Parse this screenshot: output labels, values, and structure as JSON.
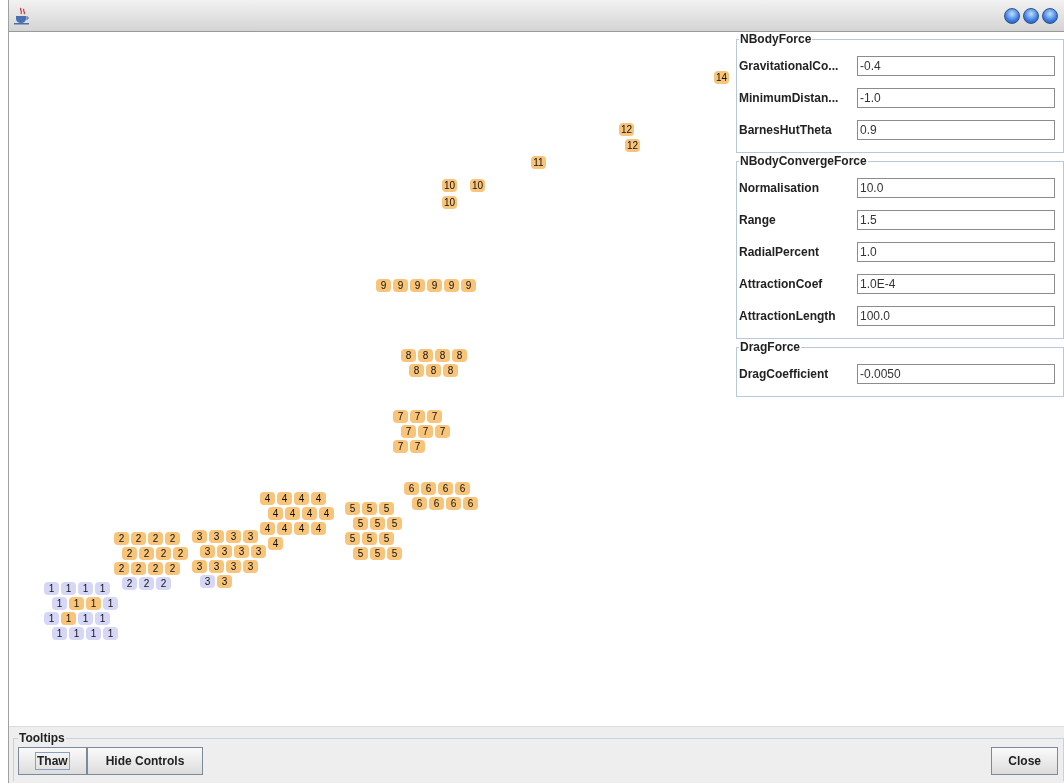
{
  "graph": {
    "clusters": [
      {
        "nodes": [
          {
            "label": "14",
            "color": "#f7c47a"
          }
        ]
      },
      {
        "nodes": [
          {
            "label": "12",
            "color": "#f7c47a"
          },
          {
            "label": "12",
            "color": "#f7c47a"
          }
        ]
      },
      {
        "nodes": [
          {
            "label": "11",
            "color": "#f7c47a"
          }
        ]
      },
      {
        "nodes": [
          {
            "label": "10",
            "color": "#f7c47a"
          },
          {
            "label": "10",
            "color": "#f7c47a"
          },
          {
            "label": "10",
            "color": "#f7c47a"
          }
        ]
      },
      {
        "nodes": [
          {
            "label": "9",
            "color": "#f7c47a"
          },
          {
            "label": "9",
            "color": "#f7c47a"
          },
          {
            "label": "9",
            "color": "#f7c47a"
          },
          {
            "label": "9",
            "color": "#f7c47a"
          },
          {
            "label": "9",
            "color": "#f7c47a"
          },
          {
            "label": "9",
            "color": "#f7c47a"
          }
        ]
      },
      {
        "nodes": [
          {
            "label": "8",
            "color": "#f7c47a"
          },
          {
            "label": "8",
            "color": "#f7c47a"
          },
          {
            "label": "8",
            "color": "#f7c47a"
          },
          {
            "label": "8",
            "color": "#f7c47a"
          },
          {
            "label": "8",
            "color": "#f7c47a"
          },
          {
            "label": "8",
            "color": "#f7c47a"
          },
          {
            "label": "8",
            "color": "#f7c47a"
          }
        ]
      },
      {
        "nodes": [
          {
            "label": "7",
            "color": "#f7c47a"
          },
          {
            "label": "7",
            "color": "#f7c47a"
          },
          {
            "label": "7",
            "color": "#f7c47a"
          },
          {
            "label": "7",
            "color": "#f7c47a"
          },
          {
            "label": "7",
            "color": "#f7c47a"
          },
          {
            "label": "7",
            "color": "#f7c47a"
          },
          {
            "label": "7",
            "color": "#f7c47a"
          },
          {
            "label": "7",
            "color": "#f7c47a"
          }
        ]
      },
      {
        "nodes": [
          {
            "label": "1",
            "color": "#d6d6f6"
          },
          {
            "label": "1",
            "color": "#d6d6f6"
          },
          {
            "label": "1",
            "color": "#d6d6f6"
          },
          {
            "label": "1",
            "color": "#d6d6f6"
          },
          {
            "label": "1",
            "color": "#d6d6f6"
          },
          {
            "label": "1",
            "color": "#f7c47a"
          },
          {
            "label": "1",
            "color": "#f7c47a"
          },
          {
            "label": "1",
            "color": "#d6d6f6"
          },
          {
            "label": "1",
            "color": "#d6d6f6"
          },
          {
            "label": "1",
            "color": "#f7c47a"
          },
          {
            "label": "1",
            "color": "#d6d6f6"
          },
          {
            "label": "1",
            "color": "#d6d6f6"
          },
          {
            "label": "1",
            "color": "#d6d6f6"
          },
          {
            "label": "1",
            "color": "#d6d6f6"
          },
          {
            "label": "1",
            "color": "#d6d6f6"
          },
          {
            "label": "1",
            "color": "#d6d6f6"
          }
        ]
      },
      {
        "nodes": [
          {
            "label": "2",
            "color": "#f7c47a"
          },
          {
            "label": "2",
            "color": "#f7c47a"
          },
          {
            "label": "2",
            "color": "#f7c47a"
          },
          {
            "label": "2",
            "color": "#f7c47a"
          },
          {
            "label": "2",
            "color": "#f7c47a"
          },
          {
            "label": "2",
            "color": "#f7c47a"
          },
          {
            "label": "2",
            "color": "#f7c47a"
          },
          {
            "label": "2",
            "color": "#f7c47a"
          },
          {
            "label": "2",
            "color": "#f7c47a"
          },
          {
            "label": "2",
            "color": "#f7c47a"
          },
          {
            "label": "2",
            "color": "#f7c47a"
          },
          {
            "label": "2",
            "color": "#f7c47a"
          },
          {
            "label": "2",
            "color": "#d6d6f6"
          },
          {
            "label": "2",
            "color": "#d6d6f6"
          },
          {
            "label": "2",
            "color": "#d6d6f6"
          }
        ]
      },
      {
        "nodes": [
          {
            "label": "3",
            "color": "#f7c47a"
          },
          {
            "label": "3",
            "color": "#f7c47a"
          },
          {
            "label": "3",
            "color": "#f7c47a"
          },
          {
            "label": "3",
            "color": "#f7c47a"
          },
          {
            "label": "3",
            "color": "#f7c47a"
          },
          {
            "label": "3",
            "color": "#f7c47a"
          },
          {
            "label": "3",
            "color": "#f7c47a"
          },
          {
            "label": "3",
            "color": "#f7c47a"
          },
          {
            "label": "3",
            "color": "#f7c47a"
          },
          {
            "label": "3",
            "color": "#f7c47a"
          },
          {
            "label": "3",
            "color": "#f7c47a"
          },
          {
            "label": "3",
            "color": "#f7c47a"
          },
          {
            "label": "3",
            "color": "#d6d6f6"
          },
          {
            "label": "3",
            "color": "#f7c47a"
          }
        ]
      },
      {
        "nodes": [
          {
            "label": "4",
            "color": "#f7c47a"
          },
          {
            "label": "4",
            "color": "#f7c47a"
          },
          {
            "label": "4",
            "color": "#f7c47a"
          },
          {
            "label": "4",
            "color": "#f7c47a"
          },
          {
            "label": "4",
            "color": "#f7c47a"
          },
          {
            "label": "4",
            "color": "#f7c47a"
          },
          {
            "label": "4",
            "color": "#f7c47a"
          },
          {
            "label": "4",
            "color": "#f7c47a"
          },
          {
            "label": "4",
            "color": "#f7c47a"
          },
          {
            "label": "4",
            "color": "#f7c47a"
          },
          {
            "label": "4",
            "color": "#f7c47a"
          },
          {
            "label": "4",
            "color": "#f7c47a"
          },
          {
            "label": "4",
            "color": "#f7c47a"
          }
        ]
      },
      {
        "nodes": [
          {
            "label": "5",
            "color": "#f7c47a"
          },
          {
            "label": "5",
            "color": "#f7c47a"
          },
          {
            "label": "5",
            "color": "#f7c47a"
          },
          {
            "label": "5",
            "color": "#f7c47a"
          },
          {
            "label": "5",
            "color": "#f7c47a"
          },
          {
            "label": "5",
            "color": "#f7c47a"
          },
          {
            "label": "5",
            "color": "#f7c47a"
          },
          {
            "label": "5",
            "color": "#f7c47a"
          },
          {
            "label": "5",
            "color": "#f7c47a"
          },
          {
            "label": "5",
            "color": "#f7c47a"
          },
          {
            "label": "5",
            "color": "#f7c47a"
          },
          {
            "label": "5",
            "color": "#f7c47a"
          }
        ]
      },
      {
        "nodes": [
          {
            "label": "6",
            "color": "#f7c47a"
          },
          {
            "label": "6",
            "color": "#f7c47a"
          },
          {
            "label": "6",
            "color": "#f7c47a"
          },
          {
            "label": "6",
            "color": "#f7c47a"
          },
          {
            "label": "6",
            "color": "#f7c47a"
          },
          {
            "label": "6",
            "color": "#f7c47a"
          },
          {
            "label": "6",
            "color": "#f7c47a"
          },
          {
            "label": "6",
            "color": "#f7c47a"
          }
        ]
      }
    ]
  },
  "controls": {
    "groups": [
      {
        "title": "NBodyForce",
        "fields": [
          {
            "label": "GravitationalCo...",
            "value": "-0.4"
          },
          {
            "label": "MinimumDistan...",
            "value": "-1.0"
          },
          {
            "label": "BarnesHutTheta",
            "value": "0.9"
          }
        ]
      },
      {
        "title": "NBodyConvergeForce",
        "fields": [
          {
            "label": "Normalisation",
            "value": "10.0"
          },
          {
            "label": "Range",
            "value": "1.5"
          },
          {
            "label": "RadialPercent",
            "value": "1.0"
          },
          {
            "label": "AttractionCoef",
            "value": "1.0E-4"
          },
          {
            "label": "AttractionLength",
            "value": "100.0"
          }
        ]
      },
      {
        "title": "DragForce",
        "fields": [
          {
            "label": "DragCoefficient",
            "value": "-0.0050"
          }
        ]
      }
    ]
  },
  "bottom": {
    "group_title": "Tooltips",
    "buttons": [
      {
        "label": "Thaw",
        "focused": true
      },
      {
        "label": "Hide Controls",
        "focused": false
      }
    ],
    "close_button": "Close"
  }
}
